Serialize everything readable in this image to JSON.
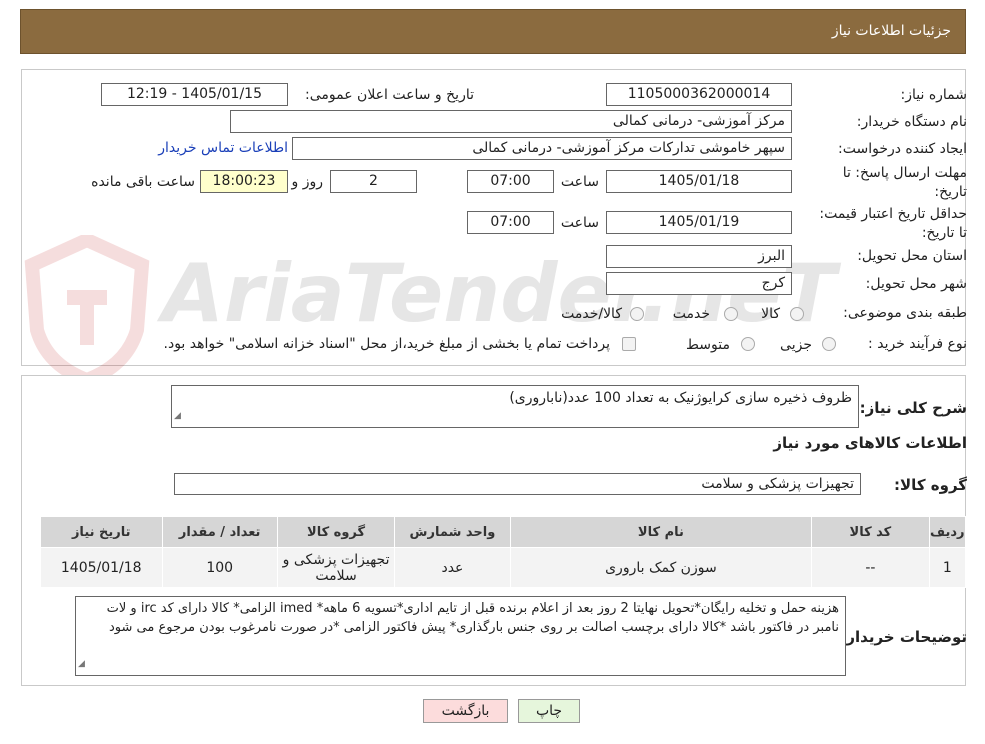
{
  "header": {
    "title": "جزئیات اطلاعات نیاز"
  },
  "need_number": {
    "label": "شماره نیاز:",
    "value": "1105000362000014"
  },
  "announce": {
    "label": "تاریخ و ساعت اعلان عمومی:",
    "value": "1405/01/15 - 12:19"
  },
  "buyer_org": {
    "label": "نام دستگاه خریدار:",
    "value": "مرکز آموزشی- درمانی کمالی"
  },
  "requester": {
    "label": "ایجاد کننده درخواست:",
    "value": "سپهر خاموشی تدارکات مرکز آموزشی- درمانی کمالی",
    "contact_link": "اطلاعات تماس خریدار"
  },
  "deadline": {
    "label": "مهلت ارسال پاسخ: تا تاریخ:",
    "date": "1405/01/18",
    "time_label": "ساعت",
    "time": "07:00",
    "days": "2",
    "days_label": "روز و",
    "remaining": "18:00:23",
    "remaining_label": "ساعت باقی مانده"
  },
  "validity": {
    "label": "حداقل تاریخ اعتبار قیمت: تا تاریخ:",
    "date": "1405/01/19",
    "time_label": "ساعت",
    "time": "07:00"
  },
  "province": {
    "label": "استان محل تحویل:",
    "value": "البرز"
  },
  "city": {
    "label": "شهر محل تحویل:",
    "value": "کرج"
  },
  "category": {
    "label": "طبقه بندی موضوعی:",
    "options": [
      "کالا",
      "خدمت",
      "کالا/خدمت"
    ]
  },
  "process": {
    "label": "نوع فرآیند خرید :",
    "options": [
      "جزیی",
      "متوسط"
    ],
    "payment_note": "پرداخت تمام یا بخشی از مبلغ خرید،از محل \"اسناد خزانه اسلامی\" خواهد بود."
  },
  "description": {
    "label": "شرح کلی نیاز:",
    "value": "ظروف ذخیره سازی کرایوژنیک به تعداد 100 عدد(ناباروری)"
  },
  "goods_section": {
    "title": "اطلاعات کالاهای مورد نیاز"
  },
  "goods_group": {
    "label": "گروه کالا:",
    "value": "تجهیزات پزشکی و سلامت"
  },
  "table": {
    "headers": [
      "ردیف",
      "کد کالا",
      "نام کالا",
      "واحد شمارش",
      "گروه کالا",
      "تعداد / مقدار",
      "تاریخ نیاز"
    ],
    "rows": [
      [
        "1",
        "--",
        "سوزن کمک باروری",
        "عدد",
        "تجهیزات پزشکی و سلامت",
        "100",
        "1405/01/18"
      ]
    ]
  },
  "buyer_notes": {
    "label": "توضیحات خریدار:",
    "value": "هزینه حمل و تخلیه رایگان*تحویل نهایتا 2 روز بعد از اعلام برنده قبل از تایم اداری*تسویه 6 ماهه* imed الزامی* کالا دارای کد irc و لات نامبر در فاکتور باشد *کالا دارای برچسب اصالت بر روی جنس بارگذاری* پیش فاکتور الزامی *در صورت نامرغوب بودن مرجوع می شود"
  },
  "buttons": {
    "print": "چاپ",
    "back": "بازگشت"
  },
  "watermark": {
    "text": "AriaTender.neT"
  },
  "colors": {
    "header_bg": "#8b6b3f",
    "back_btn": "#fcdcdc",
    "print_btn": "#e6f6dc",
    "link": "#1a3fb8"
  }
}
